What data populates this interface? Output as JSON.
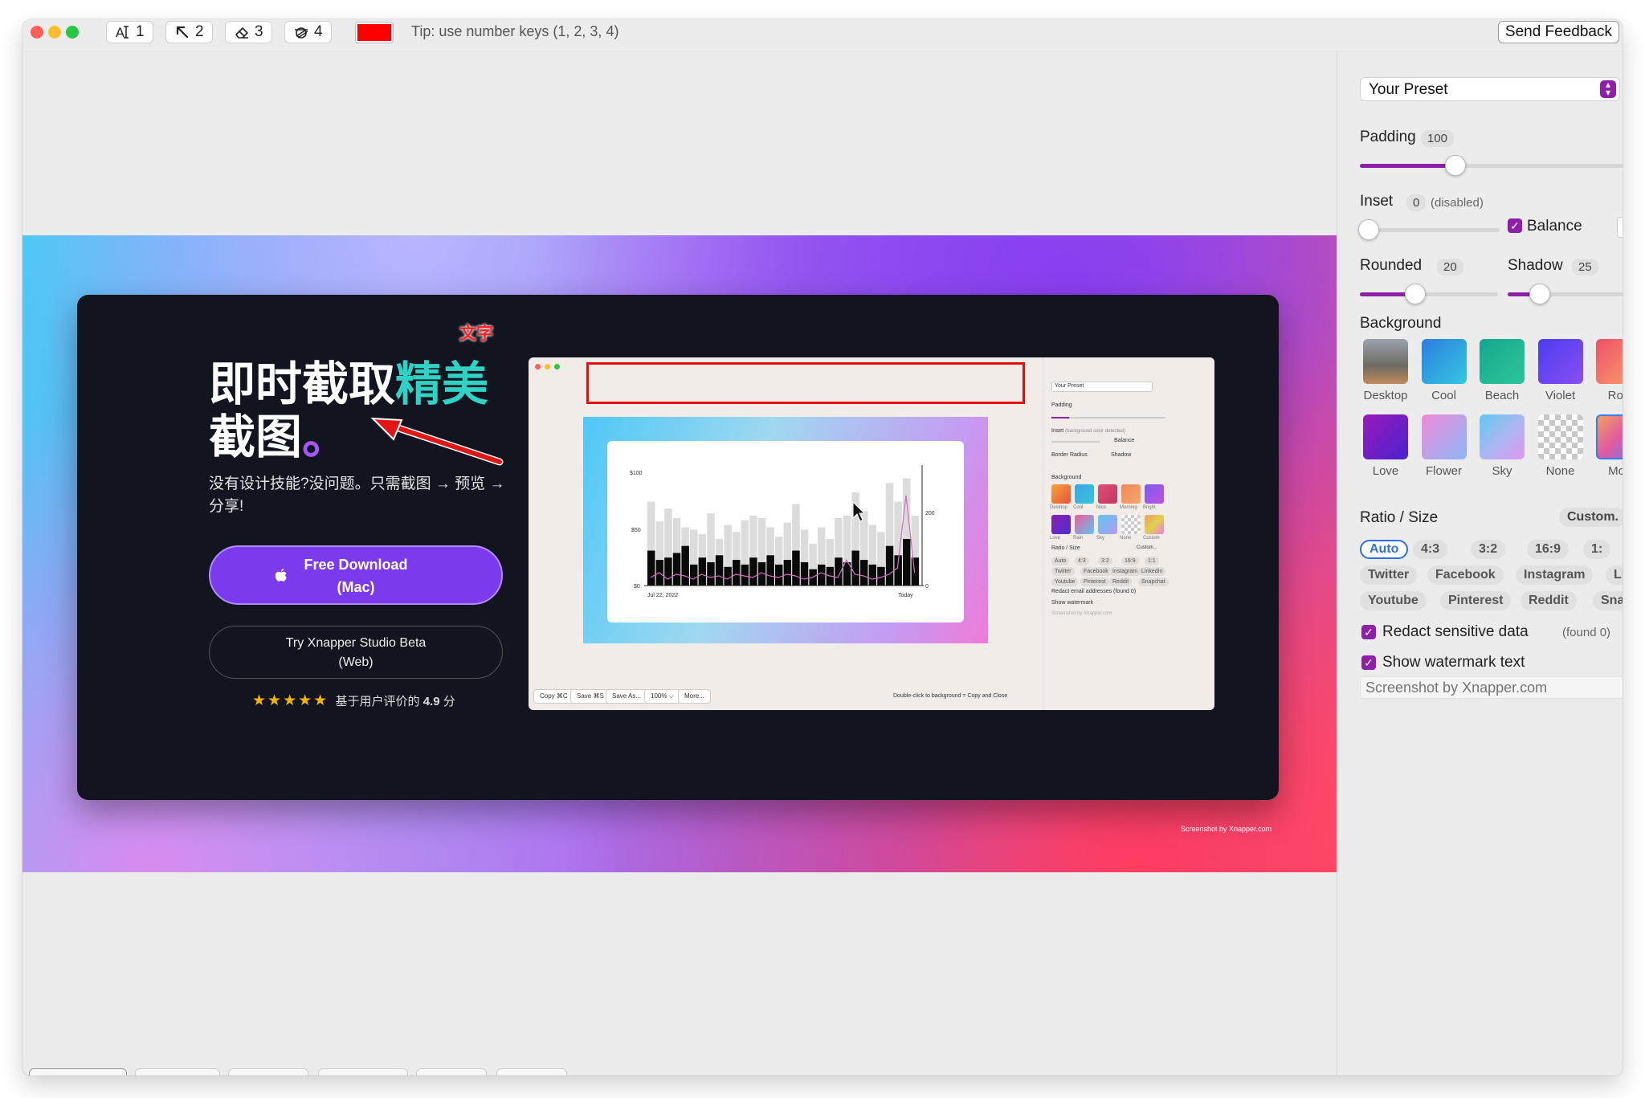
{
  "toolbar": {
    "tools": [
      {
        "icon": "text-icon",
        "key": "1"
      },
      {
        "icon": "arrow-icon",
        "key": "2"
      },
      {
        "icon": "eraser-icon",
        "key": "3"
      },
      {
        "icon": "redact-icon",
        "key": "4"
      }
    ],
    "color": "#ff0000",
    "tip": "Tip: use number keys (1, 2, 3, 4)",
    "feedback_label": "Send Feedback"
  },
  "sidebar": {
    "preset": "Your Preset",
    "padding": {
      "label": "Padding",
      "value": "100",
      "fraction": 0.35
    },
    "inset": {
      "label": "Inset",
      "value": "0",
      "note": "(disabled)",
      "fraction": 0
    },
    "balance": {
      "label": "Balance",
      "checked": true
    },
    "rounded": {
      "label": "Rounded",
      "value": "20",
      "fraction": 0.4
    },
    "shadow": {
      "label": "Shadow",
      "value": "25",
      "fraction": 0.25
    },
    "background_label": "Background",
    "backgrounds": [
      "Desktop",
      "Cool",
      "Beach",
      "Violet",
      "Ros",
      "Love",
      "Flower",
      "Sky",
      "None",
      "Mor"
    ],
    "ratio_label": "Ratio / Size",
    "custom_label": "Custom.",
    "ratios": [
      "Auto",
      "4:3",
      "3:2",
      "16:9",
      "1:"
    ],
    "socials_row1": [
      "Twitter",
      "Facebook",
      "Instagram",
      "Linke"
    ],
    "socials_row2": [
      "Youtube",
      "Pinterest",
      "Reddit",
      "Snapcl"
    ],
    "redact": {
      "label": "Redact sensitive data",
      "found": "(found 0)",
      "checked": true
    },
    "watermark": {
      "label": "Show watermark text",
      "checked": true,
      "placeholder": "Screenshot by Xnapper.com"
    }
  },
  "canvas": {
    "annotation_text": "文字",
    "headline_a": "即时截取",
    "headline_b": "精美",
    "headline_c": "截图",
    "headline_dot": "。",
    "subtitle": "没有设计技能?没问题。只需截图 → 预览 → 分享!",
    "download_line1": "Free Download",
    "download_line2": "(Mac)",
    "studio_line1": "Try Xnapper Studio Beta",
    "studio_line2": "(Web)",
    "stars": "★★★★★",
    "rating_text": "基于用户评价的",
    "rating_value": "4.9",
    "rating_unit": "分",
    "watermark": "Screenshot by Xnapper.com"
  },
  "preview": {
    "preset": "Your Preset",
    "padding": "Padding",
    "inset": "Inset",
    "inset_note": "(background color detected)",
    "balance": "Balance",
    "border_radius": "Border Radius",
    "shadow": "Shadow",
    "background": "Background",
    "bg_row1": [
      "Desktop",
      "Cool",
      "Nice",
      "Morning",
      "Bright"
    ],
    "bg_row2": [
      "Love",
      "Rain",
      "Sky",
      "None",
      "Custom"
    ],
    "ratio": "Ratio / Size",
    "custom": "Custom...",
    "ratios": [
      "Auto",
      "4:3",
      "3:2",
      "16:9",
      "1:1"
    ],
    "socials1": [
      "Twitter",
      "Facebook",
      "Instagram",
      "LinkedIn"
    ],
    "socials2": [
      "Youtube",
      "Pinterest",
      "Reddit",
      "Snapchat"
    ],
    "redact": "Redact email addresses (found 0)",
    "show_wm": "Show watermark",
    "wm_text": "Screenshot by Xnapper.com",
    "buttons": [
      "Copy ⌘C",
      "Save ⌘S",
      "Save As...",
      "100% ⌵",
      "More..."
    ],
    "hint": "Double-click to background = Copy and Close",
    "chart_y_ticks": [
      "$100",
      "$50",
      "$0"
    ],
    "chart_right_ticks": [
      "200",
      "0"
    ],
    "chart_x_start": "Jul 22, 2022",
    "chart_x_end": "Today"
  }
}
